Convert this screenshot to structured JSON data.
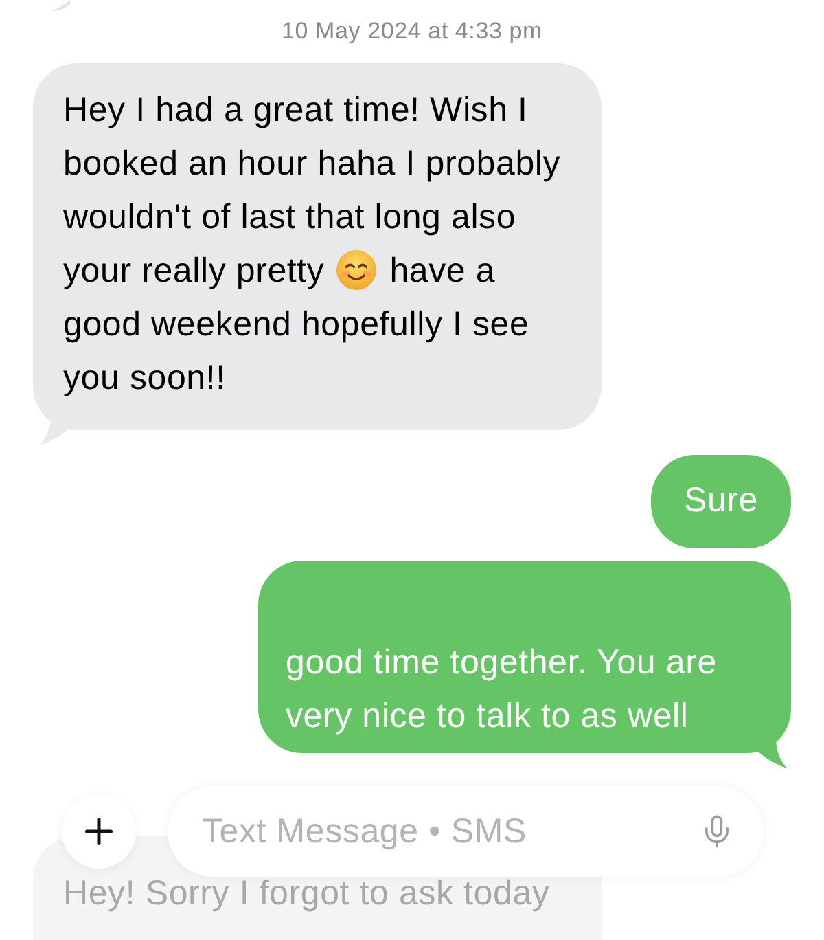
{
  "timestamp": "10 May 2024 at 4:33 pm",
  "messages": [
    {
      "kind": "incoming",
      "faded": false,
      "partly_hidden": false,
      "parts": [
        {
          "kind": "text",
          "text": "Hey I had a great time! Wish I booked an hour haha I probably wouldn't of last that long also your really pretty"
        },
        {
          "kind": "emoji"
        },
        {
          "kind": "text",
          "text": "have a good weekend hopefully I see you soon!!"
        }
      ]
    },
    {
      "kind": "outgoing",
      "faded": false,
      "partly_hidden": false,
      "parts": [
        {
          "kind": "text",
          "text": "Sure"
        }
      ]
    },
    {
      "kind": "outgoing",
      "faded": false,
      "partly_hidden": true,
      "parts": [
        {
          "kind": "text",
          "text": "good time together. You are very nice to talk to as well"
        }
      ]
    },
    {
      "kind": "incoming",
      "faded": true,
      "partly_hidden": false,
      "parts": [
        {
          "kind": "text",
          "text": "Hey! Sorry I forgot to ask today"
        }
      ]
    }
  ],
  "composer": {
    "placeholder": "Text Message • SMS"
  }
}
